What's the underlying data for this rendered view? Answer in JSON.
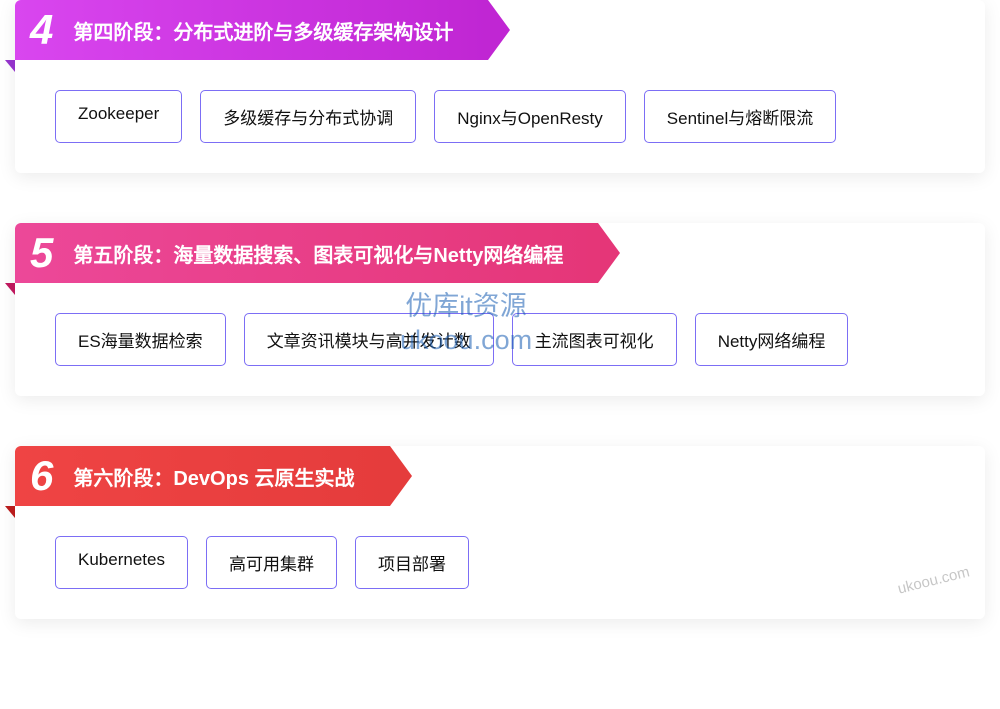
{
  "stages": [
    {
      "number": "4",
      "title": "第四阶段：分布式进阶与多级缓存架构设计",
      "color": "purple",
      "tags": [
        "Zookeeper",
        "多级缓存与分布式协调",
        "Nginx与OpenResty",
        "Sentinel与熔断限流"
      ]
    },
    {
      "number": "5",
      "title": "第五阶段：海量数据搜索、图表可视化与Netty网络编程",
      "color": "pink",
      "tags": [
        "ES海量数据检索",
        "文章资讯模块与高并发计数",
        "主流图表可视化",
        "Netty网络编程"
      ]
    },
    {
      "number": "6",
      "title": "第六阶段：DevOps 云原生实战",
      "color": "red",
      "tags": [
        "Kubernetes",
        "高可用集群",
        "项目部署"
      ]
    }
  ],
  "watermark": {
    "line1": "优库it资源",
    "line2": "ukoou.com",
    "corner": "ukoou.com"
  }
}
